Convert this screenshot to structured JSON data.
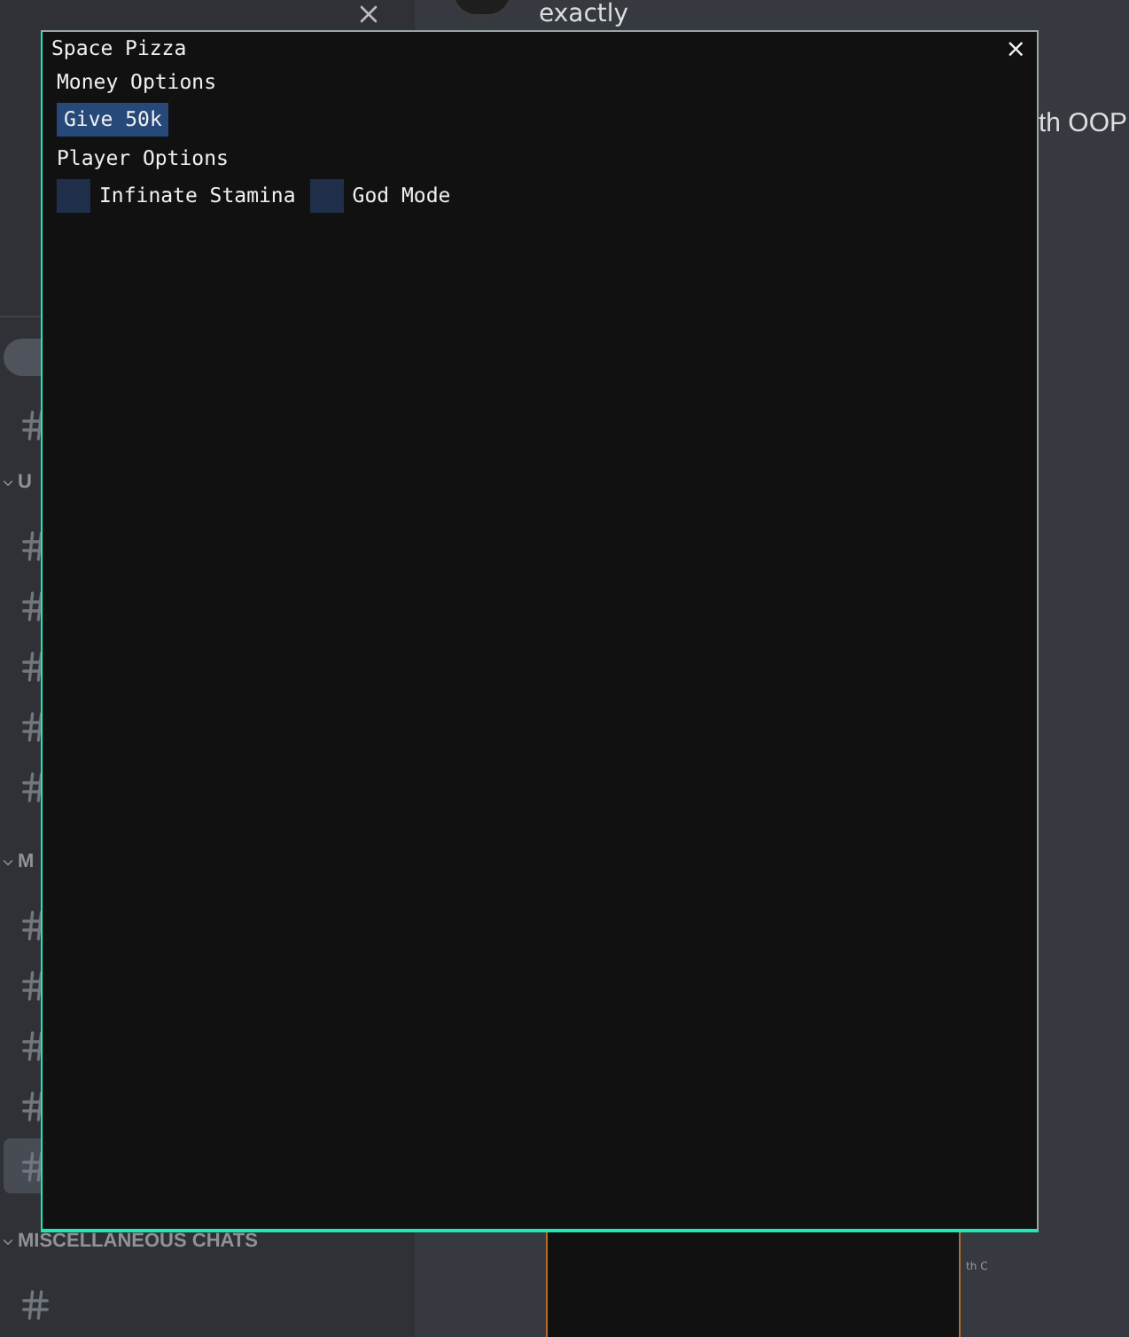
{
  "background": {
    "top_message": "exactly",
    "side_message": "th OOP",
    "mini_text": "th C",
    "sections": [
      {
        "title": "U",
        "expanded": true,
        "channels": [
          {
            "selected": false
          },
          {
            "selected": false
          },
          {
            "selected": false
          },
          {
            "selected": false
          },
          {
            "selected": false
          }
        ]
      },
      {
        "title": "M",
        "expanded": true,
        "channels": [
          {
            "selected": false
          },
          {
            "selected": false
          },
          {
            "selected": false
          },
          {
            "selected": false
          },
          {
            "selected": true
          }
        ]
      },
      {
        "title": "MISCELLANEOUS CHATS",
        "expanded": true,
        "channels": [
          {
            "selected": false
          }
        ]
      }
    ]
  },
  "window": {
    "title": "Space Pizza",
    "close": "×",
    "groups": [
      {
        "heading": "Money Options",
        "controls": [
          {
            "kind": "button",
            "label": "Give 50k"
          }
        ]
      },
      {
        "heading": "Player Options",
        "controls": [
          {
            "kind": "checkbox",
            "label": "Infinate Stamina",
            "checked": false
          },
          {
            "kind": "checkbox",
            "label": "God Mode",
            "checked": false
          }
        ]
      }
    ]
  }
}
